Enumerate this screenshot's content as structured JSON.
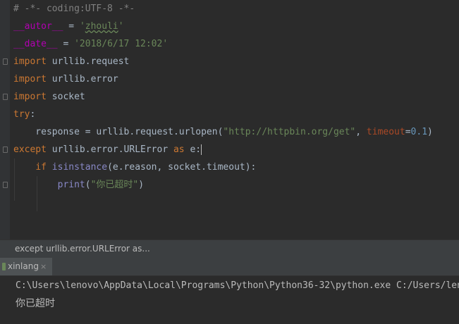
{
  "editor": {
    "comment": "# -*- coding:UTF-8 -*-",
    "autor_var": "__autor__",
    "autor_eq": " = ",
    "autor_val_open": "'",
    "autor_val": "zhouli",
    "autor_val_close": "'",
    "date_var": "__date__",
    "date_eq": " = ",
    "date_val": "'2018/6/17 12:02'",
    "import_kw": "import",
    "mod_request": " urllib.request",
    "mod_error": " urllib.error",
    "mod_socket": " socket",
    "try_kw": "try",
    "colon": ":",
    "response_prefix": "    response = urllib.request.urlopen(",
    "url": "\"http://httpbin.org/get\"",
    "comma": ", ",
    "timeout_kw": "timeout",
    "eq": "=",
    "timeout_val": "0.1",
    "close_paren": ")",
    "except_kw": "except",
    "except_mid": " urllib.error.URLError ",
    "as_kw": "as",
    "except_tail": " e:",
    "if_indent": "    ",
    "if_kw": "if",
    "isinstance_fn": " isinstance",
    "if_args": "(e.reason, socket.timeout):",
    "print_indent": "        ",
    "print_fn": "print",
    "print_open": "(",
    "print_str": "\"你已超时\"",
    "print_close": ")"
  },
  "breadcrumb": {
    "text": "except urllib.error.URLError as..."
  },
  "run_tab": {
    "label": "xinlang",
    "close": "×"
  },
  "console": {
    "command": "C:\\Users\\lenovo\\AppData\\Local\\Programs\\Python\\Python36-32\\python.exe C:/Users/lenovo/",
    "output": "你已超时"
  },
  "colors": {
    "background": "#2b2b2b",
    "keyword": "#cc7832",
    "string": "#6a8759",
    "comment": "#808080",
    "dunder": "#b200b2",
    "number": "#6897bb",
    "param": "#aa4926",
    "builtin": "#8888c6"
  }
}
